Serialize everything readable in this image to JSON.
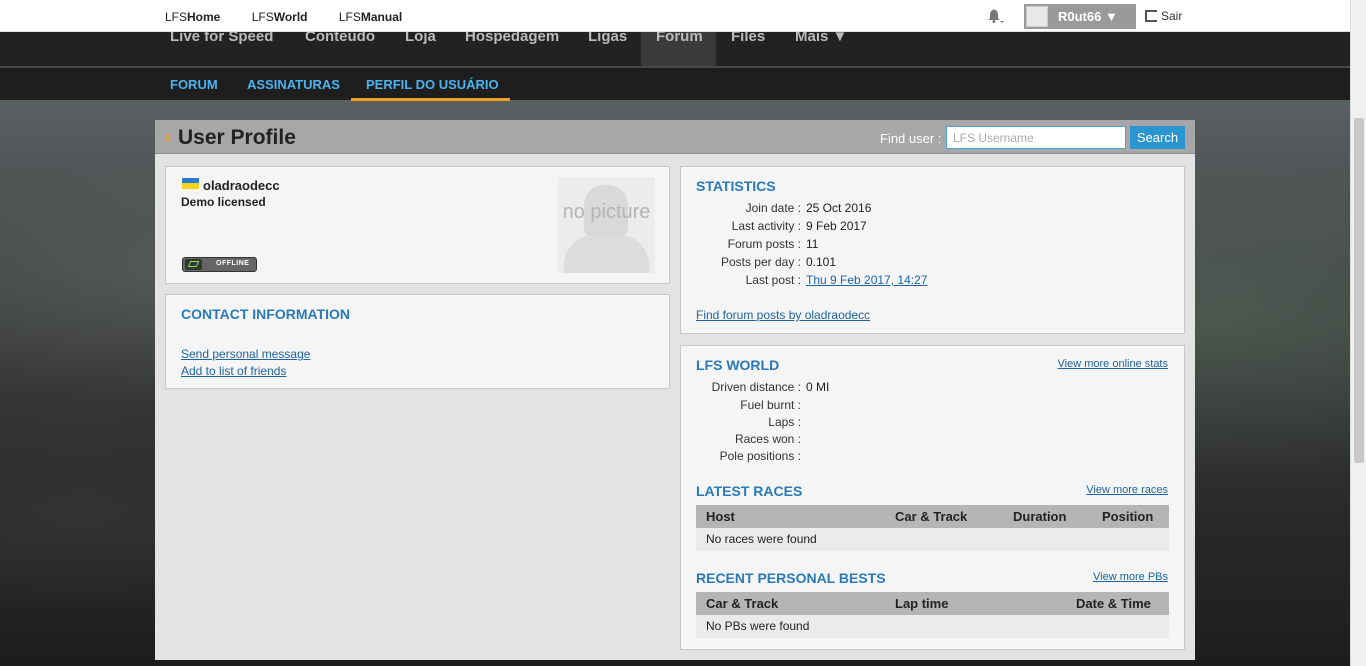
{
  "topbar": {
    "quick_links": [
      {
        "pre": "LFS",
        "bold": "Home"
      },
      {
        "pre": "LFS",
        "bold": "World"
      },
      {
        "pre": "LFS",
        "bold": "Manual"
      }
    ],
    "username": "R0ut66 ▼",
    "logout": "Sair"
  },
  "mainnav": {
    "items": [
      "Live for Speed",
      "Conteúdo",
      "Loja",
      "Hospedagem",
      "Ligas",
      "Forum",
      "Files",
      "Mais ▼"
    ],
    "active": "Forum"
  },
  "subnav": {
    "items": [
      "FORUM",
      "ASSINATURAS",
      "PERFIL DO USUÁRIO"
    ],
    "active": "PERFIL DO USUÁRIO"
  },
  "header": {
    "title": "User Profile",
    "find_label": "Find user :",
    "search_placeholder": "LFS Username",
    "search_button": "Search"
  },
  "profile": {
    "name": "oladraodecc",
    "license": "Demo licensed",
    "picture_text": "no picture",
    "status": "OFFLINE"
  },
  "contact": {
    "title": "CONTACT INFORMATION",
    "links": [
      "Send personal message",
      "Add to list of friends"
    ]
  },
  "statistics": {
    "title": "STATISTICS",
    "rows": [
      {
        "label": "Join date :",
        "value": "25 Oct 2016"
      },
      {
        "label": "Last activity :",
        "value": "9 Feb 2017"
      },
      {
        "label": "Forum posts :",
        "value": "11"
      },
      {
        "label": "Posts per day :",
        "value": "0.101"
      },
      {
        "label": "Last post :",
        "value": "Thu 9 Feb 2017, 14:27"
      }
    ],
    "find_posts": "Find forum posts by oladraodecc"
  },
  "lfsworld": {
    "title": "LFS WORLD",
    "more": "View more online stats",
    "rows": [
      {
        "label": "Driven distance :",
        "value": "0 MI"
      },
      {
        "label": "Fuel burnt :",
        "value": ""
      },
      {
        "label": "Laps :",
        "value": ""
      },
      {
        "label": "Races won :",
        "value": ""
      },
      {
        "label": "Pole positions :",
        "value": ""
      }
    ]
  },
  "races": {
    "title": "LATEST RACES",
    "more": "View more races",
    "columns": [
      "Host",
      "Car & Track",
      "Duration",
      "Position"
    ],
    "empty": "No races were found"
  },
  "pbs": {
    "title": "RECENT PERSONAL BESTS",
    "more": "View more PBs",
    "columns": [
      "Car & Track",
      "Lap time",
      "Date & Time"
    ],
    "empty": "No PBs were found"
  }
}
